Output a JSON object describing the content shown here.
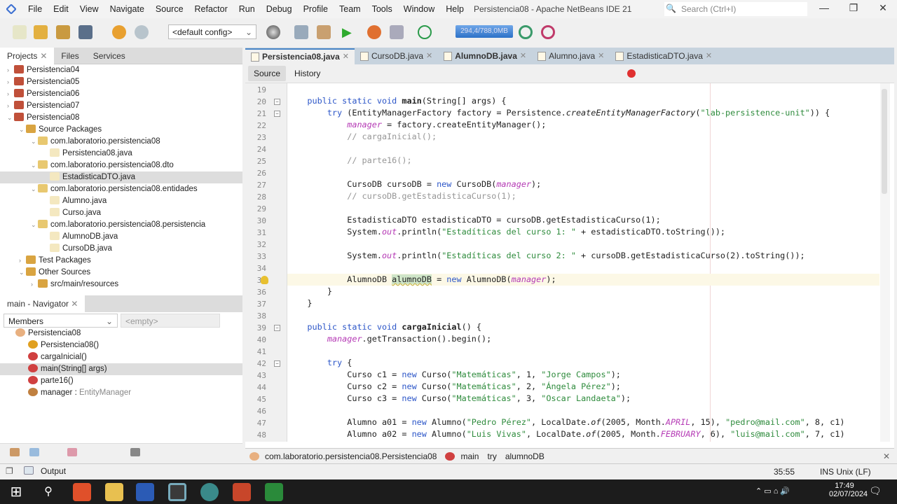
{
  "menu": [
    "File",
    "Edit",
    "View",
    "Navigate",
    "Source",
    "Refactor",
    "Run",
    "Debug",
    "Profile",
    "Team",
    "Tools",
    "Window",
    "Help"
  ],
  "window_title": "Persistencia08 - Apache NetBeans IDE 21",
  "search_placeholder": "Search (Ctrl+I)",
  "config": "<default config>",
  "memory": "294,4/788,0MB",
  "projects_tabs": [
    "Projects",
    "Files",
    "Services"
  ],
  "tree": [
    {
      "label": "Persistencia04",
      "depth": 0,
      "icon": "project",
      "chev": "›"
    },
    {
      "label": "Persistencia05",
      "depth": 0,
      "icon": "project",
      "chev": "›"
    },
    {
      "label": "Persistencia06",
      "depth": 0,
      "icon": "project",
      "chev": "›"
    },
    {
      "label": "Persistencia07",
      "depth": 0,
      "icon": "project",
      "chev": "›"
    },
    {
      "label": "Persistencia08",
      "depth": 0,
      "icon": "project",
      "chev": "⌄"
    },
    {
      "label": "Source Packages",
      "depth": 1,
      "icon": "folder",
      "chev": "⌄"
    },
    {
      "label": "com.laboratorio.persistencia08",
      "depth": 2,
      "icon": "package",
      "chev": "⌄"
    },
    {
      "label": "Persistencia08.java",
      "depth": 3,
      "icon": "java",
      "chev": ""
    },
    {
      "label": "com.laboratorio.persistencia08.dto",
      "depth": 2,
      "icon": "package",
      "chev": "⌄"
    },
    {
      "label": "EstadisticaDTO.java",
      "depth": 3,
      "icon": "java",
      "chev": "",
      "selected": true
    },
    {
      "label": "com.laboratorio.persistencia08.entidades",
      "depth": 2,
      "icon": "package",
      "chev": "⌄"
    },
    {
      "label": "Alumno.java",
      "depth": 3,
      "icon": "java",
      "chev": ""
    },
    {
      "label": "Curso.java",
      "depth": 3,
      "icon": "java",
      "chev": ""
    },
    {
      "label": "com.laboratorio.persistencia08.persistencia",
      "depth": 2,
      "icon": "package",
      "chev": "⌄"
    },
    {
      "label": "AlumnoDB.java",
      "depth": 3,
      "icon": "java",
      "chev": ""
    },
    {
      "label": "CursoDB.java",
      "depth": 3,
      "icon": "java",
      "chev": ""
    },
    {
      "label": "Test Packages",
      "depth": 1,
      "icon": "folder",
      "chev": "›"
    },
    {
      "label": "Other Sources",
      "depth": 1,
      "icon": "folder",
      "chev": "⌄"
    },
    {
      "label": "src/main/resources",
      "depth": 2,
      "icon": "folder",
      "chev": "›"
    }
  ],
  "navigator": {
    "title": "main - Navigator",
    "filter": "Members",
    "filter2": "<empty>",
    "items": [
      {
        "label": "Persistencia08",
        "depth": 0,
        "icon": "class"
      },
      {
        "label": "Persistencia08()",
        "depth": 1,
        "icon": "constructor"
      },
      {
        "label": "cargaInicial()",
        "depth": 1,
        "icon": "method"
      },
      {
        "label": "main(String[] args)",
        "depth": 1,
        "icon": "method",
        "selected": true
      },
      {
        "label": "parte16()",
        "depth": 1,
        "icon": "method"
      },
      {
        "label": "manager : ",
        "type": "EntityManager",
        "depth": 1,
        "icon": "field"
      }
    ]
  },
  "editor_tabs": [
    {
      "label": "Persistencia08.java",
      "active": true
    },
    {
      "label": "CursoDB.java"
    },
    {
      "label": "AlumnoDB.java",
      "bold": true
    },
    {
      "label": "Alumno.java"
    },
    {
      "label": "EstadisticaDTO.java"
    }
  ],
  "source_label": "Source",
  "history_label": "History",
  "code": [
    {
      "n": 19,
      "t": []
    },
    {
      "n": 20,
      "fold": "-",
      "t": [
        [
          "p",
          "    "
        ],
        [
          "kw",
          "public static void "
        ],
        [
          "b",
          "main"
        ],
        [
          "p",
          "(String[] args) {"
        ]
      ]
    },
    {
      "n": 21,
      "fold": "-",
      "t": [
        [
          "p",
          "        "
        ],
        [
          "kw",
          "try"
        ],
        [
          "p",
          " (EntityManagerFactory factory = Persistence."
        ],
        [
          "it",
          "createEntityManagerFactory"
        ],
        [
          "p",
          "("
        ],
        [
          "str",
          "\"lab-persistence-unit\""
        ],
        [
          "p",
          ")) {"
        ]
      ]
    },
    {
      "n": 22,
      "t": [
        [
          "p",
          "            "
        ],
        [
          "fld",
          "manager"
        ],
        [
          "p",
          " = factory.createEntityManager();"
        ]
      ]
    },
    {
      "n": 23,
      "t": [
        [
          "p",
          "            "
        ],
        [
          "cmt",
          "// cargaInicial();"
        ]
      ]
    },
    {
      "n": 24,
      "t": []
    },
    {
      "n": 25,
      "t": [
        [
          "p",
          "            "
        ],
        [
          "cmt",
          "// parte16();"
        ]
      ]
    },
    {
      "n": 26,
      "t": []
    },
    {
      "n": 27,
      "t": [
        [
          "p",
          "            CursoDB cursoDB = "
        ],
        [
          "kw",
          "new"
        ],
        [
          "p",
          " CursoDB("
        ],
        [
          "fld",
          "manager"
        ],
        [
          "p",
          ");"
        ]
      ]
    },
    {
      "n": 28,
      "t": [
        [
          "p",
          "            "
        ],
        [
          "cmt",
          "// cursoDB.getEstadisticaCurso(1);"
        ]
      ]
    },
    {
      "n": 29,
      "t": []
    },
    {
      "n": 30,
      "t": [
        [
          "p",
          "            EstadisticaDTO estadisticaDTO = cursoDB.getEstadisticaCurso(1);"
        ]
      ]
    },
    {
      "n": 31,
      "t": [
        [
          "p",
          "            System."
        ],
        [
          "fld",
          "out"
        ],
        [
          "p",
          ".println("
        ],
        [
          "str",
          "\"Estadíticas del curso 1: \""
        ],
        [
          "p",
          " + estadisticaDTO.toString());"
        ]
      ]
    },
    {
      "n": 32,
      "t": []
    },
    {
      "n": 33,
      "t": [
        [
          "p",
          "            System."
        ],
        [
          "fld",
          "out"
        ],
        [
          "p",
          ".println("
        ],
        [
          "str",
          "\"Estadíticas del curso 2: \""
        ],
        [
          "p",
          " + cursoDB.getEstadisticaCurso(2).toString());"
        ]
      ]
    },
    {
      "n": 34,
      "t": []
    },
    {
      "n": 35,
      "hint": true,
      "hl": true,
      "t": [
        [
          "p",
          "            AlumnoDB "
        ],
        [
          "sel2",
          "alumnoDB"
        ],
        [
          "p",
          " = "
        ],
        [
          "kw",
          "new"
        ],
        [
          "p",
          " AlumnoDB("
        ],
        [
          "fld",
          "manager"
        ],
        [
          "p",
          ");"
        ]
      ]
    },
    {
      "n": 36,
      "t": [
        [
          "p",
          "        }"
        ]
      ]
    },
    {
      "n": 37,
      "t": [
        [
          "p",
          "    }"
        ]
      ]
    },
    {
      "n": 38,
      "t": []
    },
    {
      "n": 39,
      "fold": "-",
      "t": [
        [
          "p",
          "    "
        ],
        [
          "kw",
          "public static void "
        ],
        [
          "b",
          "cargaInicial"
        ],
        [
          "p",
          "() {"
        ]
      ]
    },
    {
      "n": 40,
      "t": [
        [
          "p",
          "        "
        ],
        [
          "fld",
          "manager"
        ],
        [
          "p",
          ".getTransaction().begin();"
        ]
      ]
    },
    {
      "n": 41,
      "t": []
    },
    {
      "n": 42,
      "fold": "-",
      "t": [
        [
          "p",
          "        "
        ],
        [
          "kw",
          "try"
        ],
        [
          "p",
          " {"
        ]
      ]
    },
    {
      "n": 43,
      "t": [
        [
          "p",
          "            Curso c1 = "
        ],
        [
          "kw",
          "new"
        ],
        [
          "p",
          " Curso("
        ],
        [
          "str",
          "\"Matemáticas\""
        ],
        [
          "p",
          ", 1, "
        ],
        [
          "str",
          "\"Jorge Campos\""
        ],
        [
          "p",
          ");"
        ]
      ]
    },
    {
      "n": 44,
      "t": [
        [
          "p",
          "            Curso c2 = "
        ],
        [
          "kw",
          "new"
        ],
        [
          "p",
          " Curso("
        ],
        [
          "str",
          "\"Matemáticas\""
        ],
        [
          "p",
          ", 2, "
        ],
        [
          "str",
          "\"Ángela Pérez\""
        ],
        [
          "p",
          ");"
        ]
      ]
    },
    {
      "n": 45,
      "t": [
        [
          "p",
          "            Curso c3 = "
        ],
        [
          "kw",
          "new"
        ],
        [
          "p",
          " Curso("
        ],
        [
          "str",
          "\"Matemáticas\""
        ],
        [
          "p",
          ", 3, "
        ],
        [
          "str",
          "\"Oscar Landaeta\""
        ],
        [
          "p",
          ");"
        ]
      ]
    },
    {
      "n": 46,
      "t": []
    },
    {
      "n": 47,
      "t": [
        [
          "p",
          "            Alumno a01 = "
        ],
        [
          "kw",
          "new"
        ],
        [
          "p",
          " Alumno("
        ],
        [
          "str",
          "\"Pedro Pérez\""
        ],
        [
          "p",
          ", LocalDate."
        ],
        [
          "it",
          "of"
        ],
        [
          "p",
          "(2005, Month."
        ],
        [
          "fld",
          "APRIL"
        ],
        [
          "p",
          ", 15), "
        ],
        [
          "str",
          "\"pedro@mail.com\""
        ],
        [
          "p",
          ", 8, c1)"
        ]
      ]
    },
    {
      "n": 48,
      "t": [
        [
          "p",
          "            Alumno a02 = "
        ],
        [
          "kw",
          "new"
        ],
        [
          "p",
          " Alumno("
        ],
        [
          "str",
          "\"Luis Vivas\""
        ],
        [
          "p",
          ", LocalDate."
        ],
        [
          "it",
          "of"
        ],
        [
          "p",
          "(2005, Month."
        ],
        [
          "fld",
          "FEBRUARY"
        ],
        [
          "p",
          ", 6), "
        ],
        [
          "str",
          "\"luis@mail.com\""
        ],
        [
          "p",
          ", 7, c1)"
        ]
      ]
    }
  ],
  "breadcrumbs": [
    "com.laboratorio.persistencia08.Persistencia08",
    "main",
    "try",
    "alumnoDB"
  ],
  "status": {
    "position": "35:55",
    "mode": "INS Unix (LF)",
    "output": "Output"
  },
  "taskbar": {
    "time": "17:49",
    "date": "02/07/2024"
  }
}
